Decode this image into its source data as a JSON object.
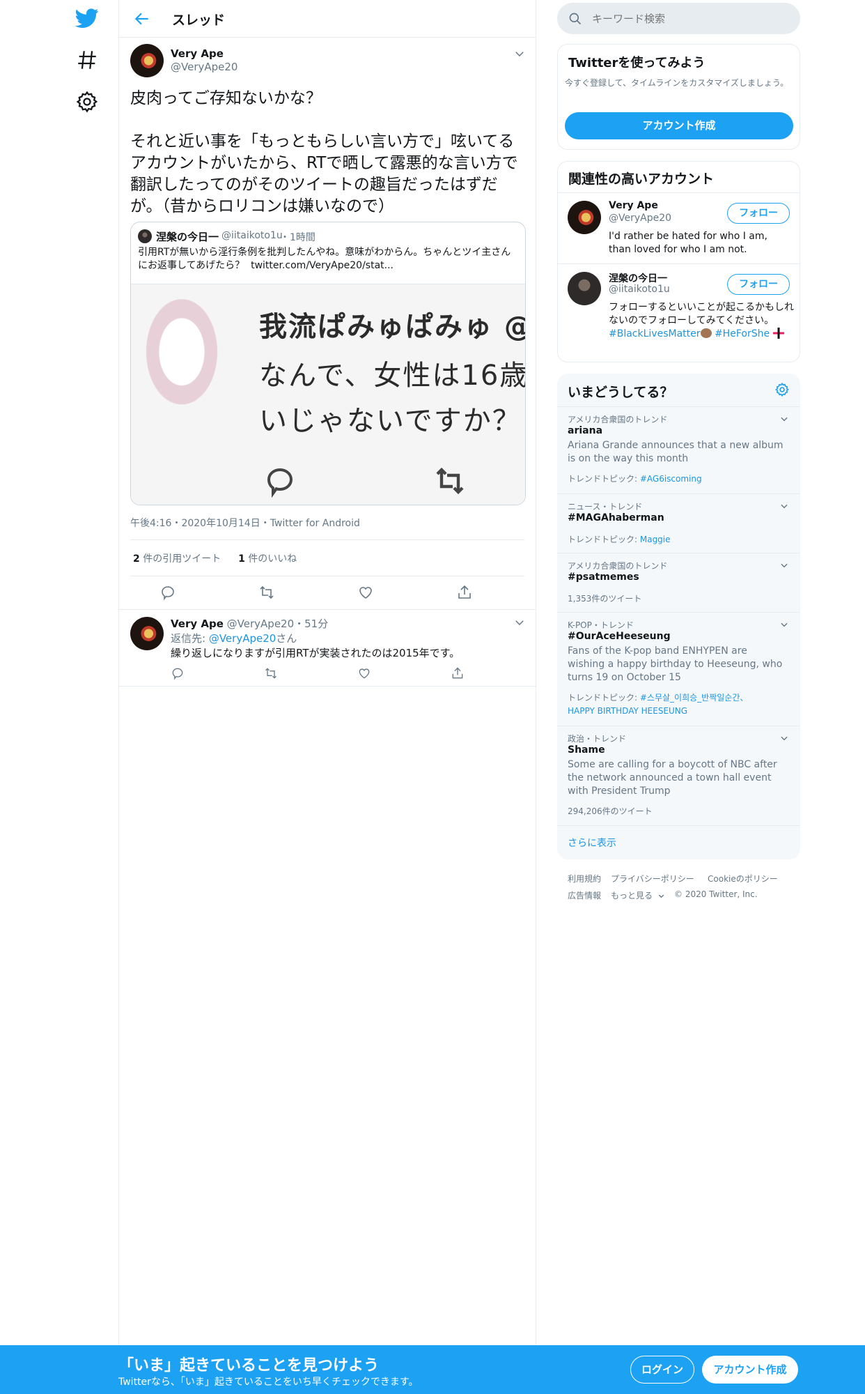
{
  "header": {
    "title": "スレッド"
  },
  "tweet": {
    "name": "Very Ape",
    "handle": "@VeryApe20",
    "text": "皮肉ってご存知ないかな？\n\nそれと近い事を「もっともらしい言い方で」呟いてるアカウントがいたから、RTで晒して露悪的な言い方で翻訳したってのがそのツイートの趣旨だったはずだが。（昔からロリコンは嫌いなので）",
    "quote": {
      "name": "涅槃の今日一",
      "handle": "@iitaikoto1u",
      "time": "1時間",
      "text": "引用RTが無いから淫行条例を批判したんやね。意味がわからん。ちゃんとツイ主さんにお返事してあげたら？",
      "link": "twitter.com/VeryApe20/stat...",
      "image_lines": [
        "我流ぱみゅぱみゅ @",
        "なんで、女性は16歳",
        "いじゃないですか？"
      ]
    },
    "meta": "午後4:16・2020年10月14日・Twitter for Android",
    "stats": {
      "quotes_count": "2",
      "quotes_label": "件の引用ツイート",
      "likes_count": "1",
      "likes_label": "件のいいね"
    }
  },
  "reply": {
    "name": "Very Ape",
    "handle": "@VeryApe20",
    "time": "・51分",
    "reply_to_prefix": "返信先: ",
    "reply_to_user": "@VeryApe20",
    "reply_to_suffix": "さん",
    "text": "繰り返しになりますが引用RTが実装されたのは2015年です。"
  },
  "search": {
    "placeholder": "キーワード検索"
  },
  "signup_card": {
    "title": "Twitterを使ってみよう",
    "text": "今すぐ登録して、タイムラインをカスタマイズしましょう。",
    "button": "アカウント作成"
  },
  "related": {
    "title": "関連性の高いアカウント",
    "follow_label": "フォロー",
    "accounts": [
      {
        "name": "Very Ape",
        "handle": "@VeryApe20",
        "bio": "I'd rather be hated for who I am, than loved for who I am not."
      },
      {
        "name": "涅槃の今日一",
        "handle": "@iitaikoto1u",
        "bio": "フォローするといいことが起こるかもしれないのでフォローしてみてください。",
        "tag1": "#BlackLivesMatter",
        "tag2": "#HeForShe"
      }
    ]
  },
  "trends": {
    "title": "いまどうしてる？",
    "items": [
      {
        "meta": "アメリカ合衆国のトレンド",
        "name": "ariana",
        "desc": "Ariana Grande announces that a new album is on the way this month",
        "topic_label": "トレンドトピック: ",
        "topic": "#AG6iscoming"
      },
      {
        "meta": "ニュース・トレンド",
        "name": "#MAGAhaberman",
        "topic_label": "トレンドトピック: ",
        "topic": "Maggie"
      },
      {
        "meta": "アメリカ合衆国のトレンド",
        "name": "#psatmemes",
        "count": "1,353件のツイート"
      },
      {
        "meta": "K-POP・トレンド",
        "name": "#OurAceHeeseung",
        "desc": "Fans of the K-pop band ENHYPEN are wishing a happy birthday to Heeseung, who turns 19 on October 15",
        "topic_label": "トレンドトピック: ",
        "topic": "#스무살_이희승_반짝일순간、",
        "topic2": "HAPPY BIRTHDAY HEESEUNG"
      },
      {
        "meta": "政治・トレンド",
        "name": "Shame",
        "desc": "Some are calling for a boycott of NBC after the network announced a town hall event with President Trump",
        "count": "294,206件のツイート"
      }
    ],
    "show_more": "さらに表示"
  },
  "footer": {
    "links": [
      "利用規約",
      "プライバシーポリシー",
      "Cookieのポリシー",
      "広告情報",
      "もっと見る"
    ],
    "copyright": "© 2020 Twitter, Inc."
  },
  "banner": {
    "title": "「いま」起きていることを見つけよう",
    "subtitle": "Twitterなら、「いま」起きていることをいち早くチェックできます。",
    "login": "ログイン",
    "signup": "アカウント作成"
  },
  "colors": {
    "accent": "#1da1f2",
    "link": "#1b95e0",
    "muted": "#657786",
    "border": "#e6ecf0"
  }
}
